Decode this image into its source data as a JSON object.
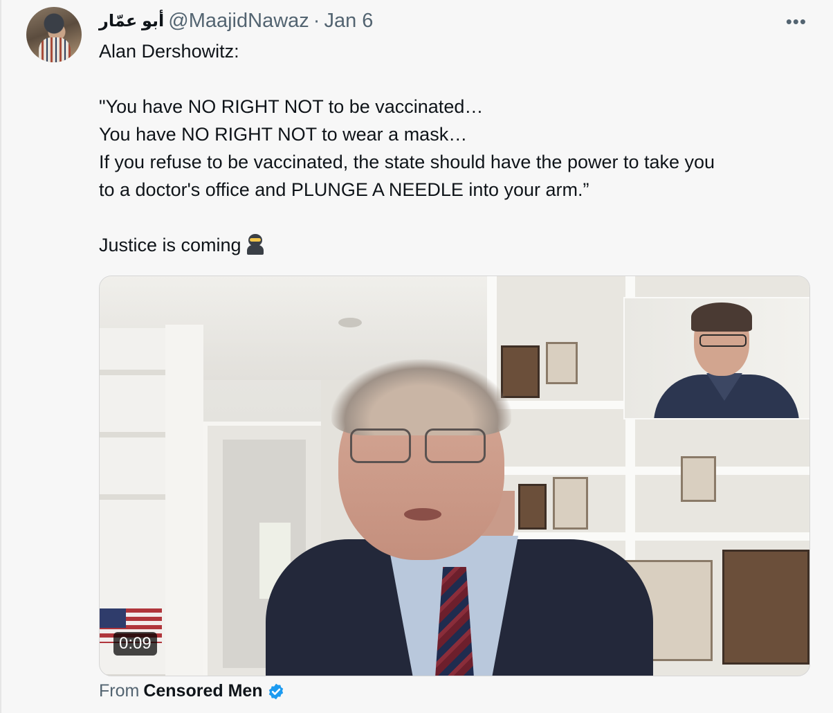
{
  "tweet": {
    "display_name": "أبو عمّار",
    "handle": "@MaajidNawaz",
    "separator": "·",
    "date": "Jan 6",
    "more_icon": "more-icon",
    "lines": [
      "Alan Dershowitz:",
      "",
      "\"You have NO RIGHT NOT to be vaccinated…",
      "You have NO RIGHT NOT to wear a mask…",
      "If you refuse to be vaccinated, the state should have the power to take you",
      "to a doctor's office and PLUNGE A NEEDLE into your arm.”",
      "",
      "Justice is coming"
    ],
    "emoji": "ninja"
  },
  "video": {
    "duration": "0:09"
  },
  "attribution": {
    "prefix": "From",
    "source": "Censored Men",
    "verified_color": "#1d9bf0"
  },
  "colors": {
    "text_primary": "#0f1419",
    "text_secondary": "#536471",
    "background": "#f7f7f7"
  }
}
